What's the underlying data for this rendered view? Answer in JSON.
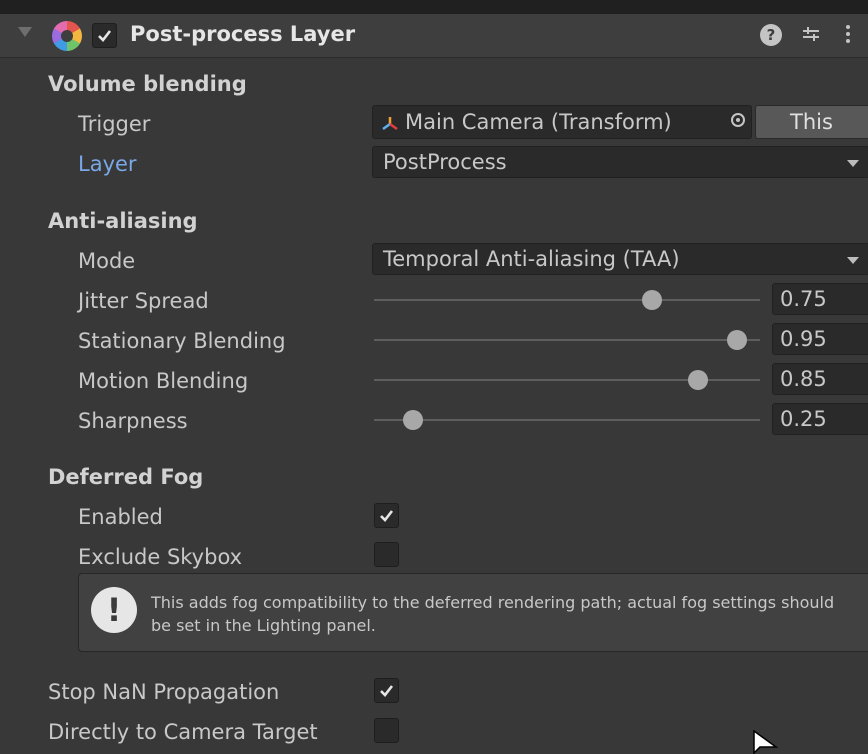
{
  "header": {
    "title": "Post-process Layer",
    "enabled": true
  },
  "volume_blending": {
    "section_label": "Volume blending",
    "trigger": {
      "label": "Trigger",
      "value": "Main Camera (Transform)",
      "button_label": "This"
    },
    "layer": {
      "label": "Layer",
      "value": "PostProcess"
    }
  },
  "anti_aliasing": {
    "section_label": "Anti-aliasing",
    "mode": {
      "label": "Mode",
      "value": "Temporal Anti-aliasing (TAA)"
    },
    "sliders": [
      {
        "label": "Jitter Spread",
        "value": "0.75",
        "fraction": 0.72
      },
      {
        "label": "Stationary Blending",
        "value": "0.95",
        "fraction": 0.94
      },
      {
        "label": "Motion Blending",
        "value": "0.85",
        "fraction": 0.84
      },
      {
        "label": "Sharpness",
        "value": "0.25",
        "fraction": 0.1
      }
    ]
  },
  "deferred_fog": {
    "section_label": "Deferred Fog",
    "enabled": {
      "label": "Enabled",
      "checked": true
    },
    "exclude_skybox": {
      "label": "Exclude Skybox",
      "checked": false
    },
    "help_text": "This adds fog compatibility to the deferred rendering path; actual fog settings should be set in the Lighting panel."
  },
  "bottom": {
    "stop_nan": {
      "label": "Stop NaN Propagation",
      "checked": true
    },
    "direct_to_target": {
      "label": "Directly to Camera Target",
      "checked": false
    }
  },
  "colors": {
    "background": "#383838",
    "header": "#3e3e3e",
    "field": "#2a2a2a",
    "highlight_label": "#7aa7e6"
  }
}
